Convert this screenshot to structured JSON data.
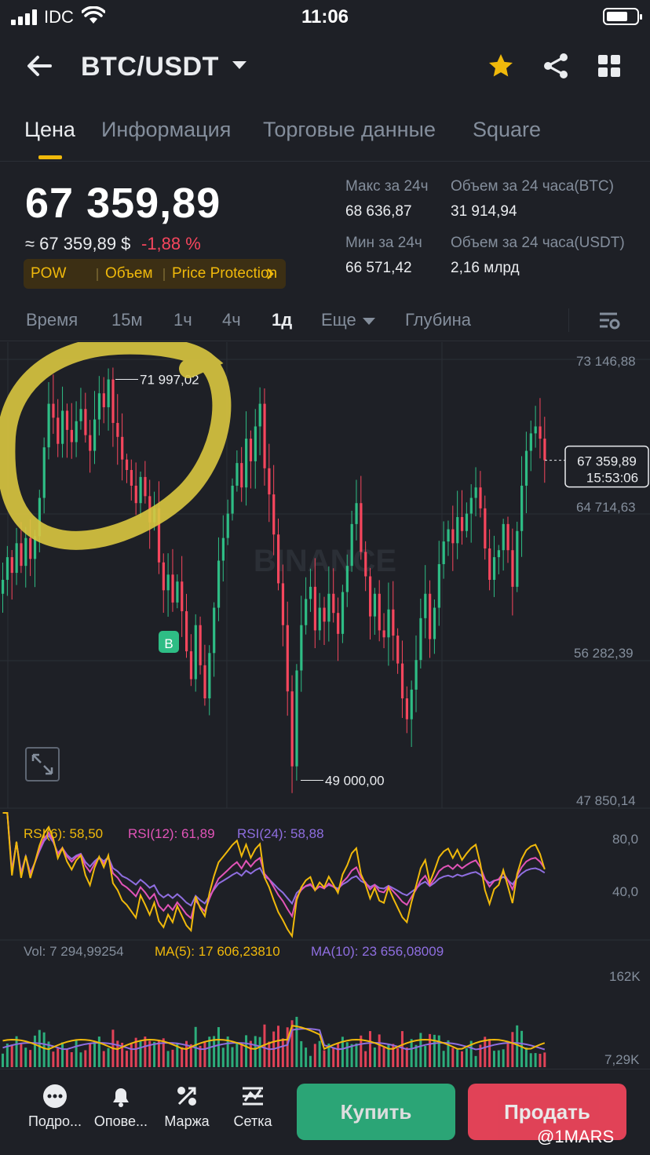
{
  "status_bar": {
    "carrier": "IDC",
    "time": "11:06"
  },
  "header": {
    "pair": "BTC/USDT"
  },
  "tabs": [
    "Цена",
    "Информация",
    "Торговые данные",
    "Square"
  ],
  "price": {
    "last": "67 359,89",
    "fiat": "≈ 67 359,89 $",
    "change": "-1,88 %",
    "tags": [
      "POW",
      "Объем",
      "Price Protection"
    ]
  },
  "stats": {
    "high_label": "Макс за 24ч",
    "high_value": "68 636,87",
    "low_label": "Мин за 24ч",
    "low_value": "66 571,42",
    "vol_btc_label": "Объем за 24 часа(BTC)",
    "vol_btc_value": "31 914,94",
    "vol_usdt_label": "Объем за 24 часа(USDT)",
    "vol_usdt_value": "2,16 млрд"
  },
  "intervals": [
    "Время",
    "15м",
    "1ч",
    "4ч",
    "1д",
    "Еще",
    "Глубина"
  ],
  "active_interval": "1д",
  "chart_labels": {
    "axis": [
      "73 146,88",
      "64 714,63",
      "56 282,39",
      "47 850,14"
    ],
    "high_marker": "71 997,02",
    "low_marker": "49 000,00",
    "last_price": "67 359,89",
    "countdown": "15:53:06",
    "buy_marker": "B",
    "watermark": "BINANCE"
  },
  "rsi": {
    "rsi6": "RSI(6): 58,50",
    "rsi12": "RSI(12): 61,89",
    "rsi24": "RSI(24): 58,88",
    "axis_high": "80,0",
    "axis_low": "40,0"
  },
  "volume": {
    "vol": "Vol: 7 294,99254",
    "ma5": "MA(5): 17 606,23810",
    "ma10": "MA(10): 23 656,08009",
    "axis_high": "162K",
    "axis_low": "7,29K"
  },
  "bottom_nav": [
    {
      "label": "Подро...",
      "icon": "more-dots-icon"
    },
    {
      "label": "Опове...",
      "icon": "bell-icon"
    },
    {
      "label": "Маржа",
      "icon": "percent-icon"
    },
    {
      "label": "Сетка",
      "icon": "grid-bot-icon"
    }
  ],
  "buttons": {
    "buy": "Купить",
    "sell": "Продать"
  },
  "overlay_tag": "@1MARS",
  "colors": {
    "up": "#2ebd85",
    "down": "#f6465d",
    "accent": "#f0b90b",
    "rsi6": "#f0b90b",
    "rsi12": "#e254b8",
    "rsi24": "#8f6ee0"
  },
  "chart_data": {
    "type": "candlestick",
    "interval": "1d",
    "ylim": [
      47850.14,
      73146.88
    ],
    "y_ticks": [
      73146.88,
      64714.63,
      56282.39,
      47850.14
    ],
    "max_marker": 71997.02,
    "min_marker": 49000.0,
    "last_price": 67359.89,
    "closes": [
      60500,
      61800,
      60900,
      62600,
      61300,
      62900,
      61700,
      63000,
      65200,
      68100,
      70600,
      69800,
      68300,
      70200,
      69100,
      68400,
      69600,
      70300,
      68800,
      67900,
      69700,
      71200,
      70400,
      71997,
      69500,
      68700,
      67400,
      66800,
      65900,
      64900,
      66400,
      65300,
      63800,
      64600,
      61500,
      59900,
      60800,
      59200,
      60400,
      58700,
      56400,
      54800,
      57900,
      55600,
      53700,
      56300,
      58900,
      61600,
      62900,
      64300,
      65900,
      67200,
      65800,
      68600,
      67300,
      69300,
      70600,
      66900,
      65400,
      63100,
      60300,
      57900,
      54100,
      49800,
      55300,
      57900,
      59400,
      60100,
      57600,
      58900,
      58100,
      59700,
      58600,
      57400,
      59800,
      61300,
      63700,
      64900,
      62100,
      60700,
      58400,
      59700,
      57600,
      57200,
      58800,
      57300,
      55700,
      53700,
      52500,
      54200,
      55900,
      58300,
      59700,
      57100,
      58900,
      61400,
      62700,
      63400,
      62600,
      64100,
      63300,
      64300,
      65200,
      65800,
      64600,
      62300,
      60500,
      61800,
      62200,
      63700,
      62200,
      60100,
      63300,
      65900,
      67900,
      68900,
      69300,
      68600,
      67360
    ]
  }
}
